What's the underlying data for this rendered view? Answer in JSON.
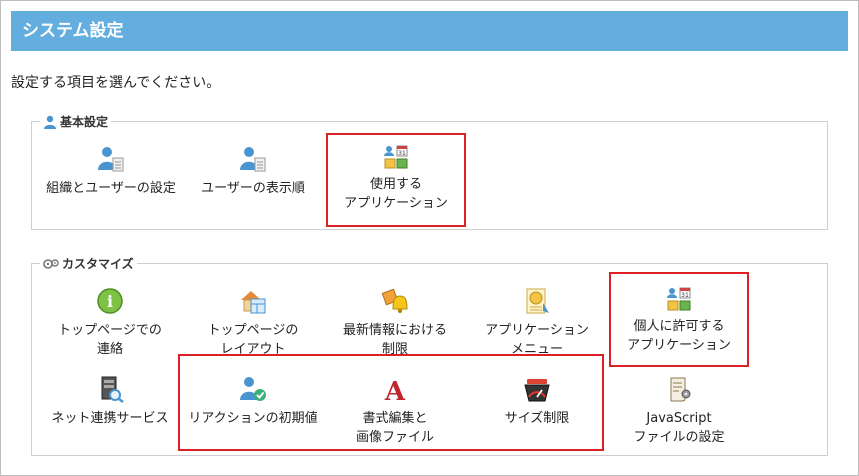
{
  "header": {
    "title": "システム設定"
  },
  "intro": "設定する項目を選んでください。",
  "basic": {
    "legend": "基本設定",
    "items": [
      {
        "l1": "組織とユーザーの設定",
        "l2": ""
      },
      {
        "l1": "ユーザーの表示順",
        "l2": ""
      },
      {
        "l1": "使用する",
        "l2": "アプリケーション"
      }
    ]
  },
  "custom": {
    "legend": "カスタマイズ",
    "items": [
      {
        "l1": "トップページでの",
        "l2": "連絡"
      },
      {
        "l1": "トップページの",
        "l2": "レイアウト"
      },
      {
        "l1": "最新情報における",
        "l2": "制限"
      },
      {
        "l1": "アプリケーション",
        "l2": "メニュー"
      },
      {
        "l1": "個人に許可する",
        "l2": "アプリケーション"
      },
      {
        "l1": "ネット連携サービス",
        "l2": ""
      },
      {
        "l1": "リアクションの初期値",
        "l2": ""
      },
      {
        "l1": "書式編集と",
        "l2": "画像ファイル"
      },
      {
        "l1": "サイズ制限",
        "l2": ""
      },
      {
        "l1": "JavaScript",
        "l2": "ファイルの設定"
      }
    ]
  },
  "icon_glyphs": {
    "calendar_day": "31",
    "font_letter": "A",
    "info": "i"
  },
  "colors": {
    "header_bg": "#63aede",
    "highlight": "#dd1f26",
    "user_blue": "#4a95cf"
  }
}
